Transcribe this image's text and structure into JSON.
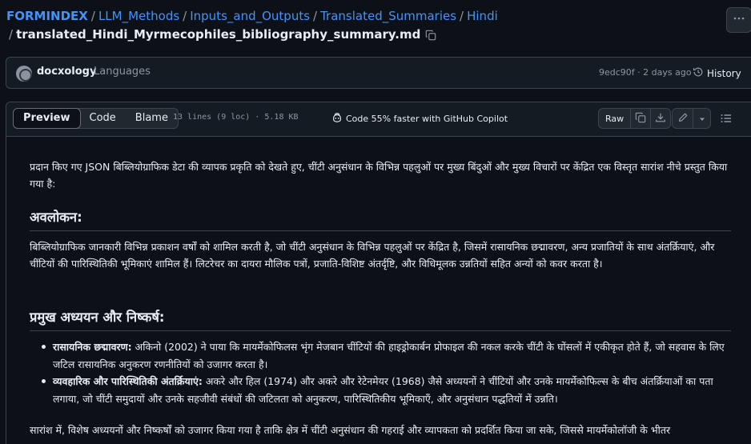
{
  "breadcrumb": {
    "items": [
      "FORMINDEX",
      "LLM_Methods",
      "Inputs_and_Outputs",
      "Translated_Summaries",
      "Hindi"
    ],
    "filename": "translated_Hindi_Myrmecophiles_bibliography_summary.md",
    "separator": "/"
  },
  "commit": {
    "author": "docxology",
    "message": "Languages",
    "sha_time": "9edc90f · 2 days ago",
    "history_label": "History"
  },
  "file": {
    "tabs": [
      "Preview",
      "Code",
      "Blame"
    ],
    "active_tab": "Preview",
    "info": "13 lines (9 loc) · 5.18 KB",
    "copilot_label": "Code 55% faster with GitHub Copilot",
    "raw_label": "Raw"
  },
  "content": {
    "intro": "प्रदान किए गए JSON बिब्लियोग्राफिक डेटा की व्यापक प्रकृति को देखते हुए, चींटी अनुसंधान के विभिन्न पहलुओं पर मुख्य बिंदुओं और मुख्य विचारों पर केंद्रित एक विस्तृत सारांश नीचे प्रस्तुत किया गया है:",
    "overview_heading": "अवलोकन:",
    "overview_text": "बिब्लियोग्राफिक जानकारी विभिन्न प्रकाशन वर्षों को शामिल करती है, जो चींटी अनुसंधान के विभिन्न पहलुओं पर केंद्रित है, जिसमें रासायनिक छद्मावरण, अन्य प्रजातियों के साथ अंतर्क्रियाएं, और चींटियों की पारिस्थितिकी भूमिकाएं शामिल हैं। लिटरेचर का दायरा मौलिक पत्रों, प्रजाति-विशिष्ट अंतर्दृष्टि, और विधिमूलक उन्नतियों सहित अन्यों को कवर करता है।",
    "studies_heading": "प्रमुख अध्ययन और निष्कर्ष:",
    "studies": [
      {
        "title": "रासायनिक छद्मावरण:",
        "text": " अकिनो (2002) ने पाया कि मायर्मेकोफिलस भृंग मेजबान चींटियों की हाइड्रोकार्बन प्रोफाइल की नकल करके चींटी के घोंसलों में एकीकृत होते हैं, जो सहवास के लिए जटिल रासायनिक अनुकरण रणनीतियों को उजागर करता है।"
      },
      {
        "title": "व्यवहारिक और पारिस्थितिकी अंतर्क्रियाएं:",
        "text": " अकरे और हिल (1974) और अकरे और रेटेनमेयर (1968) जैसे अध्ययनों ने चींटियों और उनके मायर्मेकोफिल्स के बीच अंतर्क्रियाओं का पता लगाया, जो चींटी समुदायों और उनके सहजीवी संबंधों की जटिलता को अनुकरण, पारिस्थितिकीय भूमिकाएँ, और अनुसंधान पद्धतियों में उन्नति।"
      }
    ],
    "conclusion": "सारांश में, विशेष अध्ययनों और निष्कर्षों को उजागर किया गया है ताकि क्षेत्र में चींटी अनुसंधान की गहराई और व्यापकता को प्रदर्शित किया जा सके, जिससे मायर्मेकोलॉजी के भीतर"
  }
}
